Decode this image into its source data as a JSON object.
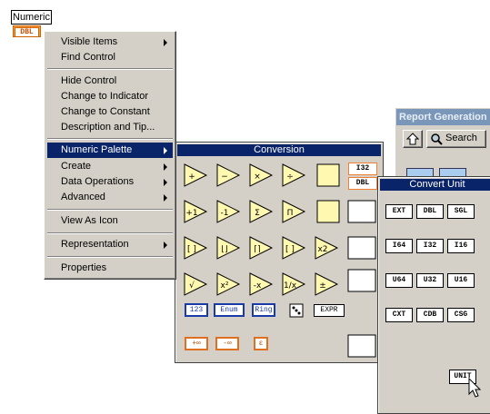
{
  "numeric_control": {
    "label": "Numeric",
    "terminal": "DBL"
  },
  "context_menu": {
    "items": [
      {
        "label": "Visible Items",
        "submenu": true
      },
      {
        "label": "Find Control",
        "submenu": false
      },
      {
        "label": "Hide Control",
        "submenu": false
      },
      {
        "label": "Change to Indicator",
        "submenu": false
      },
      {
        "label": "Change to Constant",
        "submenu": false
      },
      {
        "label": "Description and Tip...",
        "submenu": false
      },
      {
        "label": "Numeric Palette",
        "submenu": true,
        "selected": true
      },
      {
        "label": "Create",
        "submenu": true
      },
      {
        "label": "Data Operations",
        "submenu": true
      },
      {
        "label": "Advanced",
        "submenu": true
      },
      {
        "label": "View As Icon",
        "submenu": false
      },
      {
        "label": "Representation",
        "submenu": true
      },
      {
        "label": "Properties",
        "submenu": false
      }
    ]
  },
  "conversion_palette": {
    "title": "Conversion",
    "side_labels": [
      "I32",
      "DBL"
    ],
    "bottom_labels": [
      "123",
      "Enum",
      "Ring",
      "EXPR"
    ]
  },
  "report_window": {
    "title": "Report Generation",
    "search_label": "Search"
  },
  "convert_unit_palette": {
    "title": "Convert Unit",
    "types": [
      "EXT",
      "DBL",
      "SGL",
      "I64",
      "I32",
      "I16",
      "U64",
      "U32",
      "U16",
      "CXT",
      "CDB",
      "CSG",
      "UNIT"
    ]
  },
  "colors": {
    "menu_bg": "#d4d0c8",
    "selection": "#0a246a",
    "numeric_orange": "#f08030"
  }
}
